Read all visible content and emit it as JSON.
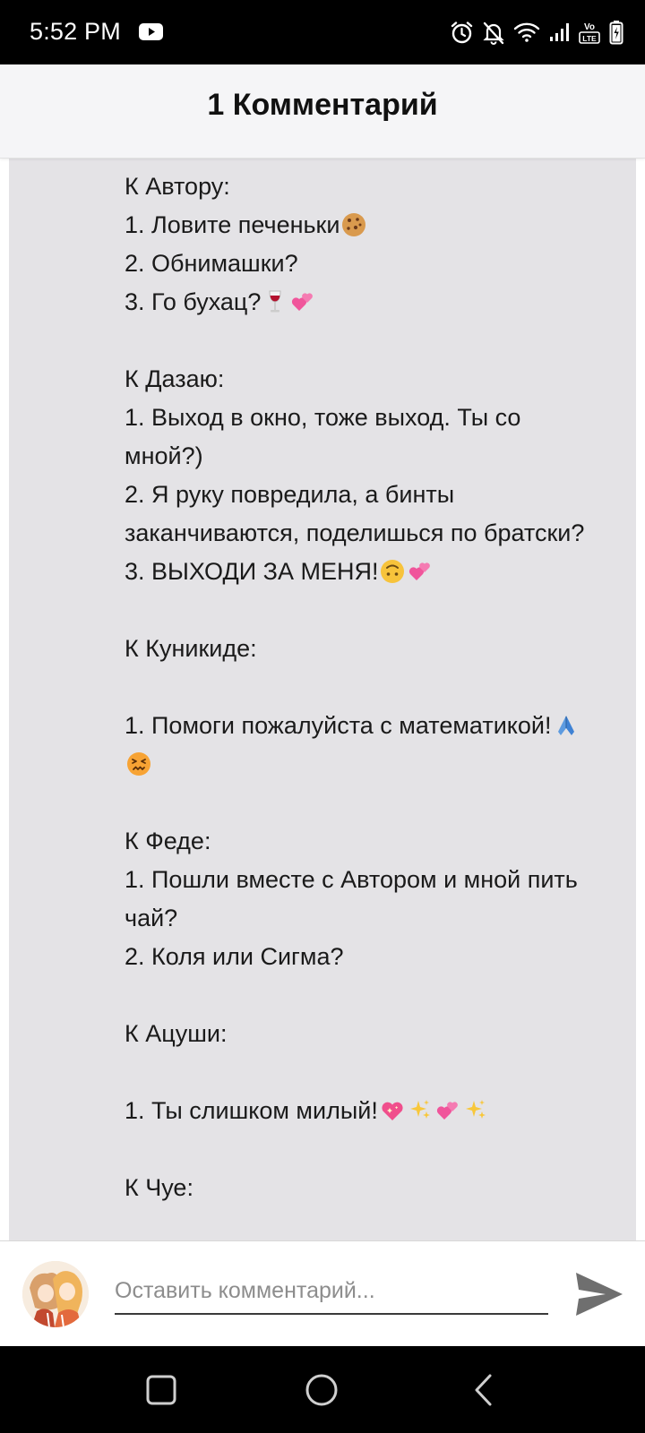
{
  "status_bar": {
    "time": "5:52 PM",
    "icons": [
      "youtube-icon",
      "alarm-icon",
      "mute-icon",
      "wifi-icon",
      "signal-icon",
      "volte-lte-icon",
      "battery-icon"
    ]
  },
  "header": {
    "title": "1 Комментарий"
  },
  "comment": {
    "lines": [
      {
        "text": "К Автору:",
        "emoji": []
      },
      {
        "text": "1. Ловите печеньки",
        "emoji": [
          "cookie"
        ]
      },
      {
        "text": "2. Обнимашки?",
        "emoji": []
      },
      {
        "text": "3. Го бухац?",
        "emoji": [
          "wine-glass",
          "two-hearts"
        ]
      },
      {
        "text": "",
        "emoji": []
      },
      {
        "text": "К Дазаю:",
        "emoji": []
      },
      {
        "text": "1. Выход в окно, тоже выход. Ты со",
        "emoji": []
      },
      {
        "text": "мной?)",
        "emoji": []
      },
      {
        "text": "2. Я руку повредила, а бинты",
        "emoji": []
      },
      {
        "text": "заканчиваются, поделишься по братски?",
        "emoji": []
      },
      {
        "text": "3. ВЫХОДИ ЗА МЕНЯ!",
        "emoji": [
          "upside-down-face",
          "two-hearts"
        ]
      },
      {
        "text": "",
        "emoji": []
      },
      {
        "text": "К Куникиде:",
        "emoji": []
      },
      {
        "text": "",
        "emoji": []
      },
      {
        "text": "1. Помоги пожалуйста с математикой!",
        "emoji": [
          "folded-hands"
        ]
      },
      {
        "text": "",
        "emoji": [
          "confounded-face"
        ]
      },
      {
        "text": "",
        "emoji": []
      },
      {
        "text": "К Феде:",
        "emoji": []
      },
      {
        "text": "1. Пошли вместе с Автором и мной пить",
        "emoji": []
      },
      {
        "text": "чай?",
        "emoji": []
      },
      {
        "text": "2. Коля или Сигма?",
        "emoji": []
      },
      {
        "text": "",
        "emoji": []
      },
      {
        "text": "К Ацуши:",
        "emoji": []
      },
      {
        "text": "",
        "emoji": []
      },
      {
        "text": "1. Ты слишком милый!",
        "emoji": [
          "sparkling-heart",
          "sparkles",
          "two-hearts",
          "sparkles"
        ]
      },
      {
        "text": "",
        "emoji": []
      },
      {
        "text": "К Чуе:",
        "emoji": []
      }
    ]
  },
  "input_bar": {
    "placeholder": "Оставить комментарий...",
    "value": ""
  },
  "colors": {
    "card_background": "#e4e3e6",
    "header_background": "#f5f5f7",
    "send_icon": "#6f6f6f"
  }
}
